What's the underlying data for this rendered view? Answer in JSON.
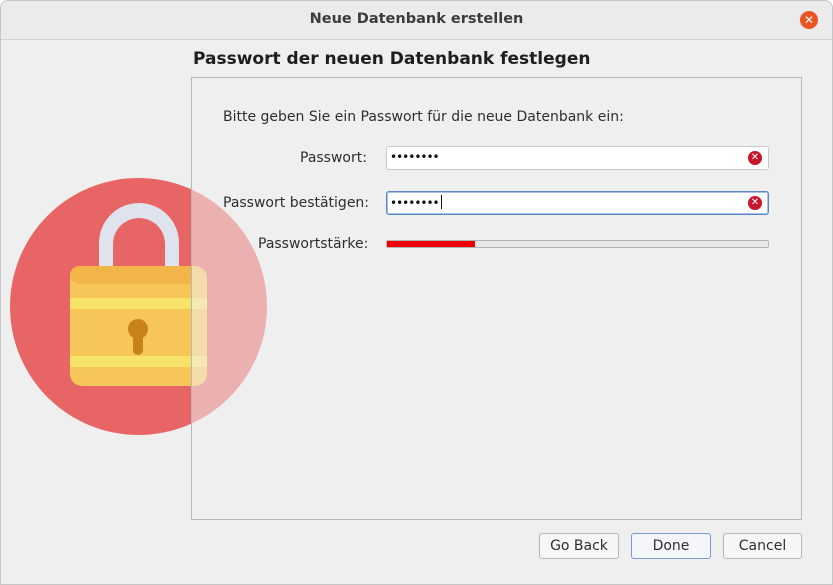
{
  "window": {
    "title": "Neue Datenbank erstellen",
    "close_icon": "close-icon"
  },
  "heading": "Passwort der neuen Datenbank festlegen",
  "intro": "Bitte geben Sie ein Passwort für die neue Datenbank ein:",
  "password": {
    "label": "Passwort:",
    "value": "••••••••"
  },
  "confirm": {
    "label": "Passwort bestätigen:",
    "value": "••••••••"
  },
  "strength": {
    "label": "Passwortstärke:",
    "level": 0.23
  },
  "buttons": {
    "back": "Go Back",
    "done": "Done",
    "cancel": "Cancel"
  },
  "colors": {
    "accent": "#e95420",
    "strength_fill": "#ee0000",
    "clear": "#c7162b"
  }
}
